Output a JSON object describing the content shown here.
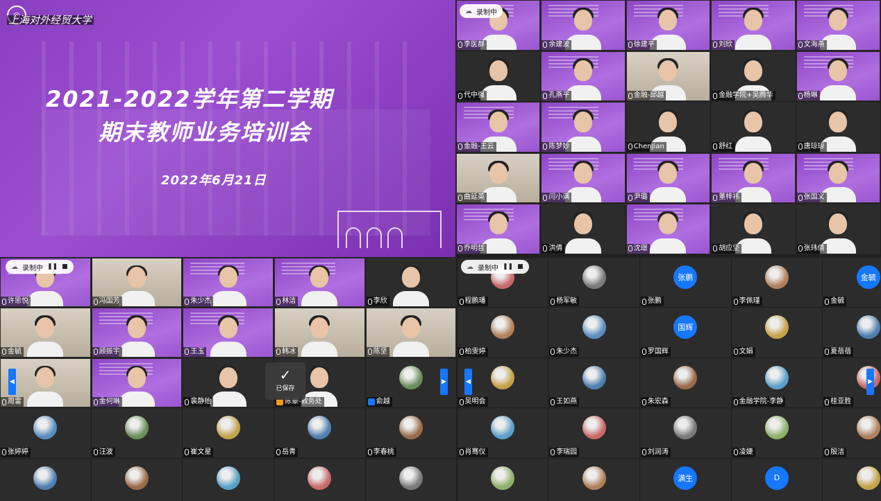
{
  "slide": {
    "school_name": "上海对外经贸大学",
    "title_line1": "2021-2022学年第二学期",
    "title_line2": "期末教师业务培训会",
    "date": "2022年6月21日"
  },
  "recording": {
    "label": "录制中"
  },
  "saved_toast": {
    "label": "已保存"
  },
  "top_grid": [
    [
      "李医群",
      "余建波",
      "徐建平",
      "刘欣",
      "文海燕"
    ],
    [
      "代中强",
      "孔燕平",
      "金融-邱越",
      "金融学院+吴腾华",
      "杨琳"
    ],
    [
      "金融-王云",
      "陈梦妙",
      "ChenJian",
      "舒红",
      "唐琼琼"
    ],
    [
      "曲延英",
      "闫小满",
      "尹璐",
      "董梓祎",
      "张国义"
    ],
    [
      "乔明哲",
      "洪倩",
      "沈璟",
      "胡应坚",
      "张玮倩"
    ]
  ],
  "grid_rows": [
    [
      "许思悦",
      "冯国芳",
      "朱少杰",
      "林洁",
      "李欣",
      "程鹏璠",
      "杨军敏",
      "张鹏",
      "李佩瑾",
      "金毓"
    ],
    [
      "金毓",
      "顾振宇",
      "王玉",
      "韩冰",
      "陈坚",
      "柏雯婷",
      "朱少杰",
      "罗国辉",
      "文娟",
      "夏蓓蓓"
    ],
    [
      "周雷",
      "金何琳",
      "裴静贻",
      "陈豪-教务处",
      "俞越",
      "吴明会",
      "王如燕",
      "朱宏森",
      "金融学院-李静",
      "桂亚胜"
    ],
    [
      "张婷婷",
      "汪波",
      "崔文星",
      "岳青",
      "李春桃",
      "肖骞仪",
      "李瑞园",
      "刘润涛",
      "凌婕",
      "殷洁"
    ]
  ],
  "avatar_labels": {
    "r0c7": "张鹏",
    "r0c9": "金毓",
    "r1c7": "国辉",
    "r4c7": "满生",
    "r4c8": "D"
  }
}
